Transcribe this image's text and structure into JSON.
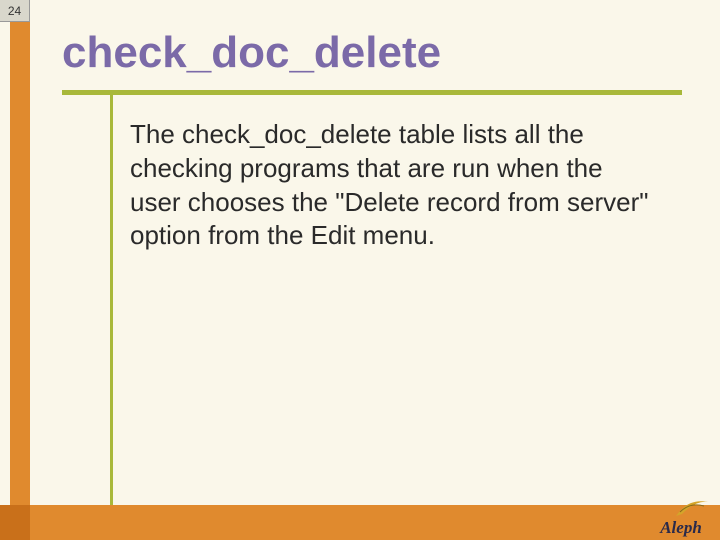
{
  "page_number": "24",
  "title": "check_doc_delete",
  "body": "The check_doc_delete table lists all the checking programs that are run when the user chooses the \"Delete record from server\" option from the Edit menu.",
  "logo_text": "Aleph",
  "colors": {
    "background": "#faf7ea",
    "orange": "#e08a2e",
    "green": "#a8b83a",
    "purple": "#7b6aa8"
  }
}
